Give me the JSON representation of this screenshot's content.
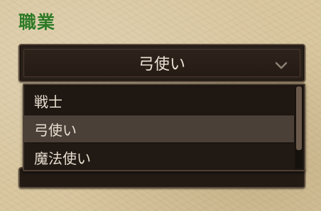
{
  "field": {
    "label": "職業"
  },
  "select": {
    "value": "弓使い",
    "options": [
      {
        "label": "戦士",
        "selected": false
      },
      {
        "label": "弓使い",
        "selected": true
      },
      {
        "label": "魔法使い",
        "selected": false
      }
    ],
    "open": true
  },
  "icons": {
    "chevron": "chevron-down-icon"
  },
  "colors": {
    "label": "#2f7a26",
    "panel": "#2a201a",
    "highlight": "#4a4038",
    "text": "#ece3d6"
  }
}
